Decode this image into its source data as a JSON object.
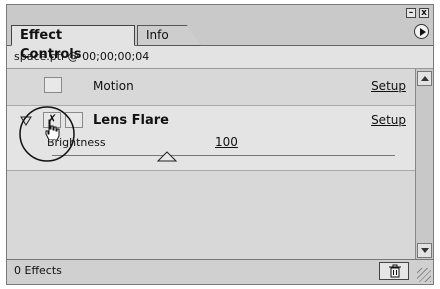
{
  "tabs": [
    {
      "label": "Effect Controls",
      "active": true
    },
    {
      "label": "Info",
      "active": false
    }
  ],
  "window_buttons": {
    "minimize": "–",
    "close": "x"
  },
  "clip_info": "space.ptl @ 00;00;00;04",
  "effects": [
    {
      "name": "Motion",
      "setup_label": "Setup",
      "bold": false
    },
    {
      "name": "Lens Flare",
      "setup_label": "Setup",
      "bold": true,
      "enabled_check": "✗"
    }
  ],
  "lens_flare_params": {
    "name": "Brightness",
    "value": "100"
  },
  "status": {
    "text": "0 Effects"
  },
  "icons": {
    "menu": "menu-arrow-icon",
    "trash": "trash-icon",
    "hand": "hand-cursor-icon"
  },
  "colors": {
    "window_bg": "#d8d8d8",
    "highlight_row": "#e4e4e4"
  }
}
